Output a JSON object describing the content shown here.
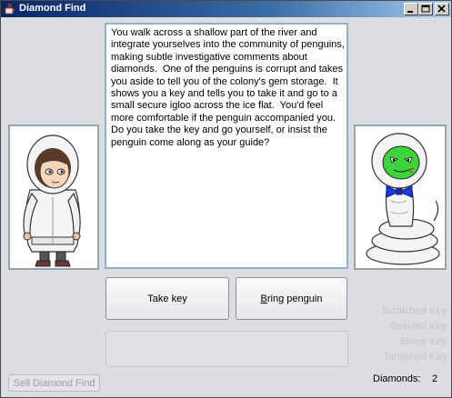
{
  "window": {
    "title": "Diamond Find",
    "accent_color": "#0a246a"
  },
  "story": {
    "text": "You walk across a shallow part of the river and integrate yourselves into the community of penguins, making subtle investigative comments about diamonds.  One of the penguins is corrupt and takes you aside to tell you of the colony's gem storage.  It shows you a key and tells you to take it and go to a small secure igloo across the ice flat.  You'd feel more comfortable if the penguin accompanied you.  Do you take the key and go yourself, or insist the penguin come along as your guide?"
  },
  "choices": {
    "take_key": "Take key",
    "bring_penguin_mnemonic": "B",
    "bring_penguin_rest": "ring penguin"
  },
  "keys": [
    "Scratched Key",
    "Beveled Key",
    "Sharp Key",
    "Tarnished Key"
  ],
  "status": {
    "diamonds_label": "Diamonds:",
    "diamonds_count": "2"
  },
  "sell_button": "Sell Diamond Find",
  "icons": {
    "app": "java-cup-icon",
    "minimize": "minimize-icon",
    "maximize": "maximize-icon",
    "close": "close-icon"
  }
}
